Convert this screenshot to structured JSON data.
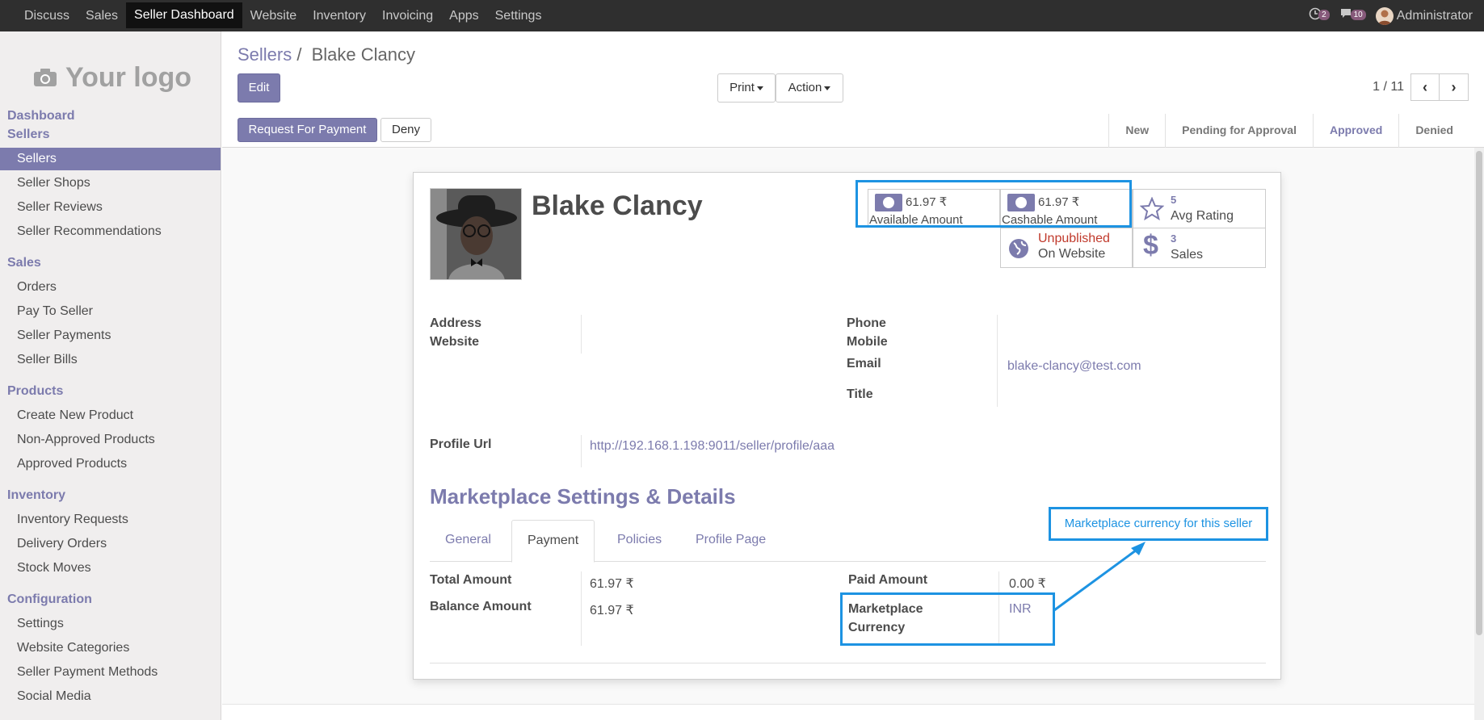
{
  "topnav": {
    "items": [
      "Discuss",
      "Sales",
      "Seller Dashboard",
      "Website",
      "Inventory",
      "Invoicing",
      "Apps",
      "Settings"
    ],
    "active": "Seller Dashboard",
    "activity_count": "2",
    "messages_count": "10",
    "user": "Administrator"
  },
  "sidebar": {
    "logo_text": "Your logo",
    "groups": [
      {
        "title": "Dashboard"
      },
      {
        "title": "Sellers",
        "items": [
          "Sellers",
          "Seller Shops",
          "Seller Reviews",
          "Seller Recommendations"
        ]
      },
      {
        "title": "Sales",
        "items": [
          "Orders",
          "Pay To Seller",
          "Seller Payments",
          "Seller Bills"
        ]
      },
      {
        "title": "Products",
        "items": [
          "Create New Product",
          "Non-Approved Products",
          "Approved Products"
        ]
      },
      {
        "title": "Inventory",
        "items": [
          "Inventory Requests",
          "Delivery Orders",
          "Stock Moves"
        ]
      },
      {
        "title": "Configuration",
        "items": [
          "Settings",
          "Website Categories",
          "Seller Payment Methods",
          "Social Media"
        ]
      }
    ],
    "active_item": "Sellers"
  },
  "control_panel": {
    "breadcrumb_parent": "Sellers",
    "breadcrumb_sep": "/",
    "breadcrumb_current": "Blake Clancy",
    "edit_label": "Edit",
    "print_label": "Print",
    "action_label": "Action",
    "pager": "1 / 11"
  },
  "statusbar": {
    "request_payment_label": "Request For Payment",
    "deny_label": "Deny",
    "stages": [
      "New",
      "Pending for Approval",
      "Approved",
      "Denied"
    ],
    "current_stage": "Approved"
  },
  "seller": {
    "name": "Blake Clancy",
    "stats": {
      "available_amount": {
        "value": "61.97 ₹",
        "label": "Available Amount"
      },
      "cashable_amount": {
        "value": "61.97 ₹",
        "label": "Cashable Amount"
      },
      "avg_rating": {
        "value": "5",
        "label": "Avg Rating"
      },
      "website": {
        "value": "Unpublished",
        "label": "On Website"
      },
      "sales": {
        "value": "3",
        "label": "Sales"
      }
    },
    "fields_left": {
      "address_label": "Address",
      "website_label": "Website"
    },
    "fields_right": {
      "phone_label": "Phone",
      "mobile_label": "Mobile",
      "email_label": "Email",
      "email_value": "blake-clancy@test.com",
      "title_label": "Title"
    },
    "profile_url_label": "Profile Url",
    "profile_url_value": "http://192.168.1.198:9011/seller/profile/aaa"
  },
  "marketplace": {
    "section_title": "Marketplace Settings & Details",
    "tabs": [
      "General",
      "Payment",
      "Policies",
      "Profile Page"
    ],
    "active_tab": "Payment",
    "total_amount_label": "Total Amount",
    "total_amount_value": "61.97 ₹",
    "balance_amount_label": "Balance Amount",
    "balance_amount_value": "61.97 ₹",
    "paid_amount_label": "Paid Amount",
    "paid_amount_value": "0.00 ₹",
    "currency_label": "Marketplace Currency",
    "currency_value": "INR"
  },
  "annotation": {
    "note": "Marketplace currency for this seller",
    "color": "#1d93e2"
  },
  "colors": {
    "brand": "#7c7bad",
    "topbar": "#2f2f2f",
    "unpublished": "#c0392b"
  }
}
